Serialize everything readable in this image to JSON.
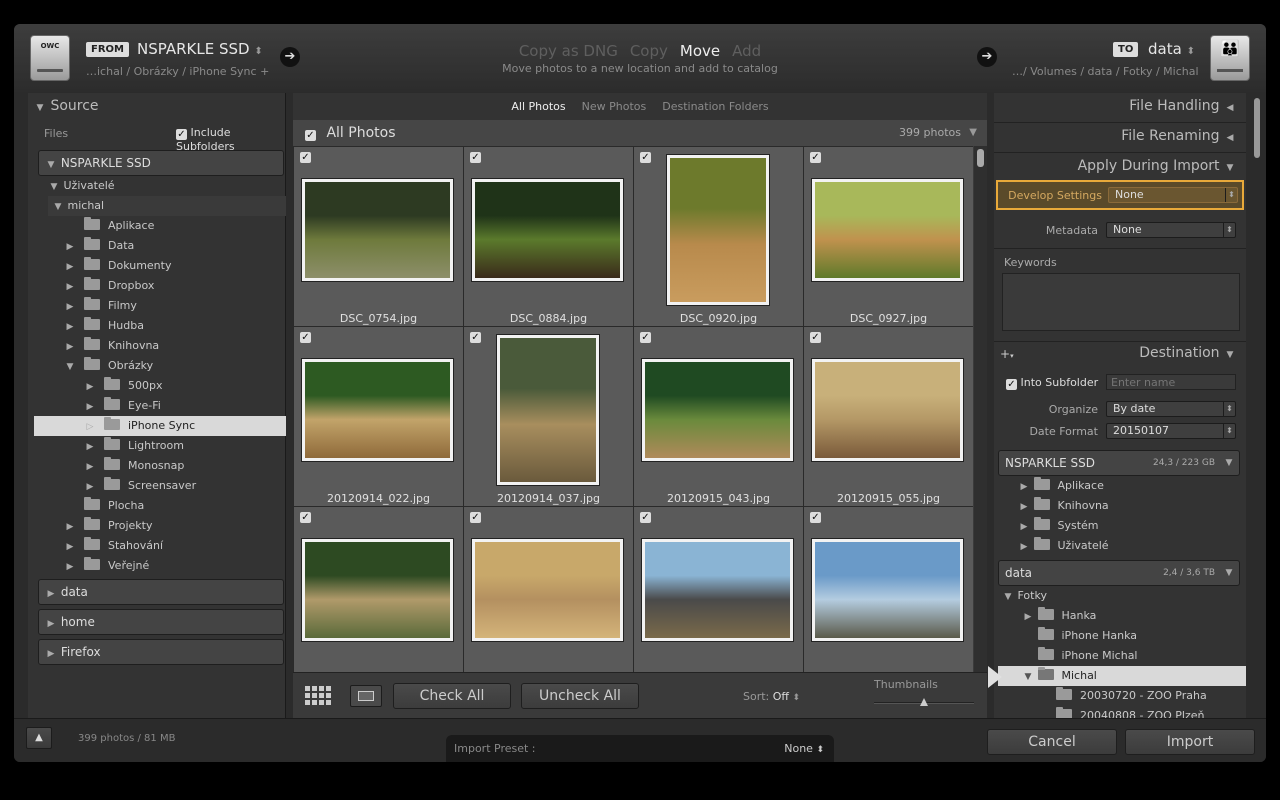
{
  "topbar": {
    "from_label": "FROM",
    "source_name": "NSPARKLE SSD",
    "source_path": "…ichal / Obrázky / iPhone Sync +",
    "modes": [
      "Copy as DNG",
      "Copy",
      "Move",
      "Add"
    ],
    "active_mode": "Move",
    "mode_description": "Move photos to a new location and add to catalog",
    "to_label": "TO",
    "dest_name": "data",
    "dest_path": "…/ Volumes / data / Fotky / Michal",
    "drive_label": "OWC"
  },
  "source": {
    "title": "Source",
    "files_label": "Files",
    "include_subfolders": "Include Subfolders",
    "volume": "NSPARKLE SSD",
    "user_folder": "Uživatelé",
    "home_folder": "michal",
    "folders": [
      {
        "name": "Aplikace",
        "level": 2,
        "expanded": false,
        "arrow": false
      },
      {
        "name": "Data",
        "level": 2,
        "arrow": true
      },
      {
        "name": "Dokumenty",
        "level": 2,
        "arrow": true
      },
      {
        "name": "Dropbox",
        "level": 2,
        "arrow": true
      },
      {
        "name": "Filmy",
        "level": 2,
        "arrow": true
      },
      {
        "name": "Hudba",
        "level": 2,
        "arrow": true
      },
      {
        "name": "Knihovna",
        "level": 2,
        "arrow": true
      },
      {
        "name": "Obrázky",
        "level": 2,
        "arrow": true,
        "expanded": true
      },
      {
        "name": "500px",
        "level": 3,
        "arrow": true
      },
      {
        "name": "Eye-Fi",
        "level": 3,
        "arrow": true
      },
      {
        "name": "iPhone Sync",
        "level": 3,
        "arrow": true,
        "selected": true
      },
      {
        "name": "Lightroom",
        "level": 3,
        "arrow": true
      },
      {
        "name": "Monosnap",
        "level": 3,
        "arrow": true
      },
      {
        "name": "Screensaver",
        "level": 3,
        "arrow": true
      },
      {
        "name": "Plocha",
        "level": 2,
        "arrow": false
      },
      {
        "name": "Projekty",
        "level": 2,
        "arrow": true
      },
      {
        "name": "Stahování",
        "level": 2,
        "arrow": true
      },
      {
        "name": "Veřejné",
        "level": 2,
        "arrow": true
      }
    ],
    "other_volumes": [
      "data",
      "home",
      "Firefox"
    ]
  },
  "center": {
    "tabs": [
      "All Photos",
      "New Photos",
      "Destination Folders"
    ],
    "active_tab": "All Photos",
    "grid_title": "All Photos",
    "photo_count": "399 photos",
    "photos": [
      {
        "name": "DSC_0754.jpg",
        "orient": "land",
        "colors": [
          "#2d3a22",
          "#6e7a3c",
          "#8d8f6a"
        ]
      },
      {
        "name": "DSC_0884.jpg",
        "orient": "land",
        "colors": [
          "#1f3318",
          "#5b7a2c",
          "#3a2a1a"
        ]
      },
      {
        "name": "DSC_0920.jpg",
        "orient": "port",
        "colors": [
          "#6d7a2c",
          "#b88a4c",
          "#c99c5e"
        ]
      },
      {
        "name": "DSC_0927.jpg",
        "orient": "land",
        "colors": [
          "#a8b85a",
          "#c0924e",
          "#5f7a2a"
        ]
      },
      {
        "name": "20120914_022.jpg",
        "orient": "land",
        "colors": [
          "#2d5a22",
          "#c2a46a",
          "#8f6a3a"
        ]
      },
      {
        "name": "20120914_037.jpg",
        "orient": "port",
        "colors": [
          "#4a5a3a",
          "#a88e5e",
          "#6a5a3c"
        ]
      },
      {
        "name": "20120915_043.jpg",
        "orient": "land",
        "colors": [
          "#1f4a22",
          "#6a8a3c",
          "#b08a5a"
        ]
      },
      {
        "name": "20120915_055.jpg",
        "orient": "land",
        "colors": [
          "#c8b07a",
          "#b49866",
          "#7a5a3a"
        ]
      },
      {
        "name": "",
        "orient": "land",
        "colors": [
          "#2d4a22",
          "#b09a6a",
          "#5a6a3a"
        ]
      },
      {
        "name": "",
        "orient": "land",
        "colors": [
          "#c8a86a",
          "#b49060",
          "#d4b47a"
        ]
      },
      {
        "name": "",
        "orient": "land",
        "colors": [
          "#8ab4d4",
          "#4a4a4a",
          "#7a6a4a"
        ]
      },
      {
        "name": "",
        "orient": "land",
        "colors": [
          "#6a9ac8",
          "#b4cce0",
          "#5a5a4a"
        ]
      }
    ],
    "check_all": "Check All",
    "uncheck_all": "Uncheck All",
    "sort_label": "Sort:",
    "sort_value": "Off",
    "thumbnails_label": "Thumbnails",
    "thumb_slider_level": 0.5
  },
  "right": {
    "file_handling": "File Handling",
    "file_renaming": "File Renaming",
    "apply_during_import": "Apply During Import",
    "develop_settings_label": "Develop Settings",
    "develop_settings_value": "None",
    "metadata_label": "Metadata",
    "metadata_value": "None",
    "keywords_label": "Keywords",
    "destination": "Destination",
    "into_subfolder": "Into Subfolder",
    "subfolder_placeholder": "Enter name",
    "organize_label": "Organize",
    "organize_value": "By date",
    "date_format_label": "Date Format",
    "date_format_value": "20150107",
    "vol1_name": "NSPARKLE SSD",
    "vol1_space": "24,3 / 223 GB",
    "vol1_folders": [
      "Aplikace",
      "Knihovna",
      "Systém",
      "Uživatelé"
    ],
    "vol2_name": "data",
    "vol2_space": "2,4 / 3,6 TB",
    "vol2_root": "Fotky",
    "vol2_folders": [
      "Hanka",
      "iPhone Hanka",
      "iPhone Michal"
    ],
    "selected_folder": "Michal",
    "sub_folders": [
      "20030720 - ZOO Praha",
      "20040808 - ZOO Plzeň"
    ]
  },
  "footer": {
    "status": "399 photos / 81 MB",
    "import_preset_label": "Import Preset :",
    "import_preset_value": "None",
    "cancel": "Cancel",
    "import": "Import"
  },
  "colors": {
    "highlight": "#e8a93a",
    "panel": "#333333",
    "background": "#2b2b2b"
  }
}
